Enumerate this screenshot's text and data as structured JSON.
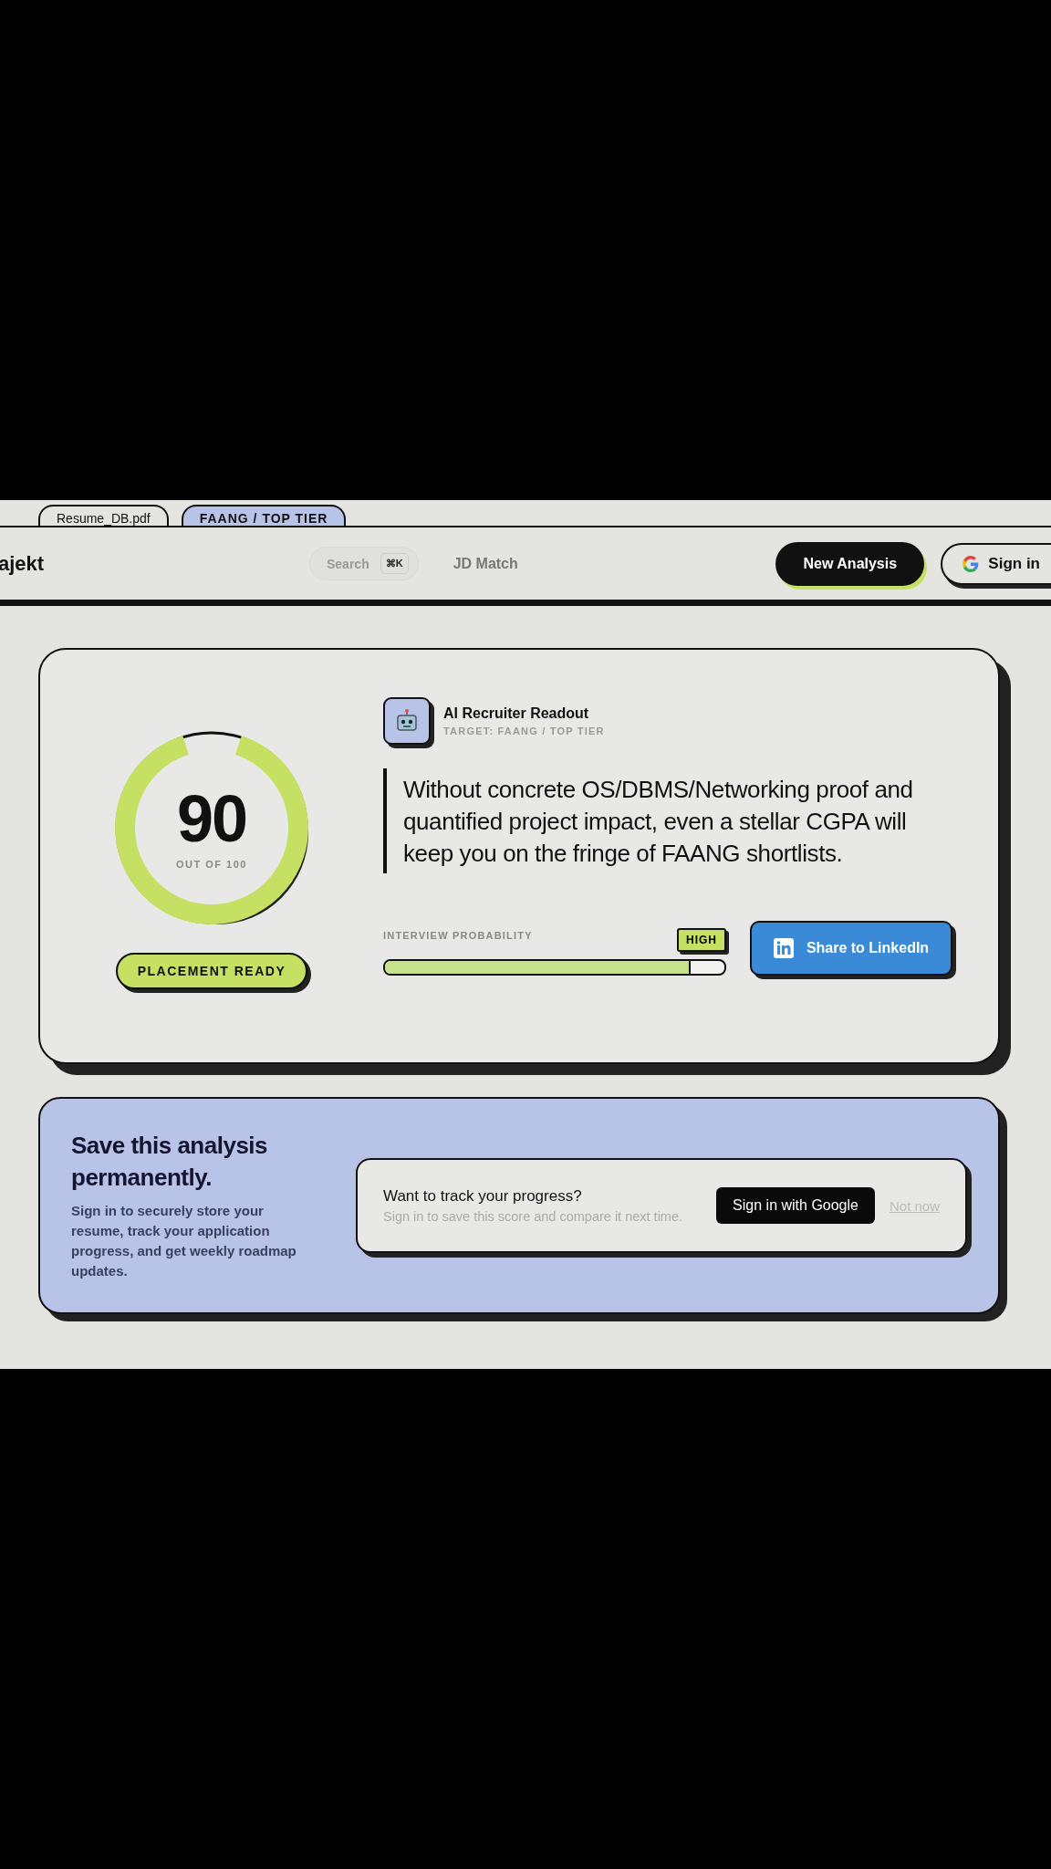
{
  "file_tabs": [
    {
      "label": "Resume_DB.pdf",
      "selected": false
    },
    {
      "label": "FAANG / TOP TIER",
      "selected": true
    }
  ],
  "nav": {
    "brand": "ajekt",
    "search": {
      "placeholder": "Search",
      "shortcut": "⌘K"
    },
    "links": [
      "JD Match"
    ],
    "primary_button": "New Analysis",
    "signin_button": "Sign in"
  },
  "score_card": {
    "score": "90",
    "score_caption": "OUT OF 100",
    "level": 0.9,
    "status_badge": "PLACEMENT READY",
    "readout_title": "AI Recruiter Readout",
    "readout_target": "TARGET: FAANG / TOP TIER",
    "quote": "Without concrete OS/DBMS/Networking proof and quantified project impact, even a stellar CGPA will keep you on the fringe of FAANG shortlists.",
    "probability": {
      "label": "INTERVIEW PROBABILITY",
      "badge": "HIGH",
      "level": 0.9
    },
    "share_button": "Share to LinkedIn"
  },
  "save_panel": {
    "title": "Save this analysis permanently.",
    "description": "Sign in to securely store your resume, track your application progress, and get weekly roadmap updates.",
    "prompt_title": "Want to track your progress?",
    "prompt_text": "Sign in to save this score and compare it next time.",
    "google_button": "Sign in with Google",
    "dismiss_link": "Not now"
  }
}
